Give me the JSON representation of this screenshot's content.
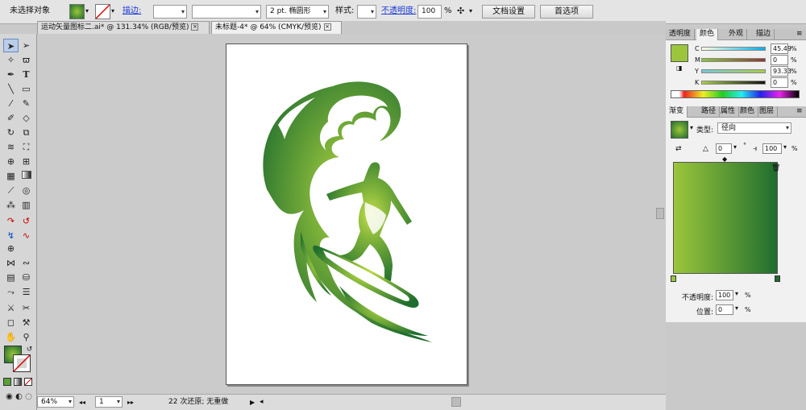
{
  "control_bar": {
    "selection": "未选择对象",
    "stroke_label": "描边:",
    "stroke_weight": "2 pt. 椭圆形",
    "style_label": "样式:",
    "opacity_label": "不透明度:",
    "opacity_value": "100",
    "opacity_unit": "%",
    "doc_setup": "文档设置",
    "preferences": "首选项",
    "colors": {
      "fill": "#2f8a2f",
      "accent_link": "#1a3bd6"
    }
  },
  "tabs": [
    {
      "label": "运动矢量图标二.ai* @ 131.34% (RGB/预览)"
    },
    {
      "label": "未标题-4* @ 64% (CMYK/预览)"
    }
  ],
  "status_bar": {
    "zoom": "64%",
    "page": "1",
    "message": "22 次还原; 无重做"
  },
  "color_panel": {
    "tabs": [
      "透明度",
      "颜色",
      "外观",
      "描边"
    ],
    "active_tab": "颜色",
    "channels": [
      {
        "name": "C",
        "value": "45.49"
      },
      {
        "name": "M",
        "value": "0"
      },
      {
        "name": "Y",
        "value": "93.33"
      },
      {
        "name": "K",
        "value": "0"
      }
    ],
    "swatch_color": "#9bc63b"
  },
  "gradient_panel": {
    "tabs": [
      "渐变",
      "路径",
      "属性",
      "颜色",
      "图层"
    ],
    "active_tab": "渐变",
    "type_label": "类型:",
    "type_value": "径向",
    "angle_value": "0",
    "angle_unit": "°",
    "ratio_value": "100",
    "ratio_unit": "%",
    "opacity_label": "不透明度:",
    "opacity_value": "100",
    "opacity_unit": "%",
    "location_label": "位置:",
    "location_value": "0",
    "location_unit": "%",
    "colors": {
      "start": "#9bc63b",
      "end": "#1f6d2e"
    }
  }
}
